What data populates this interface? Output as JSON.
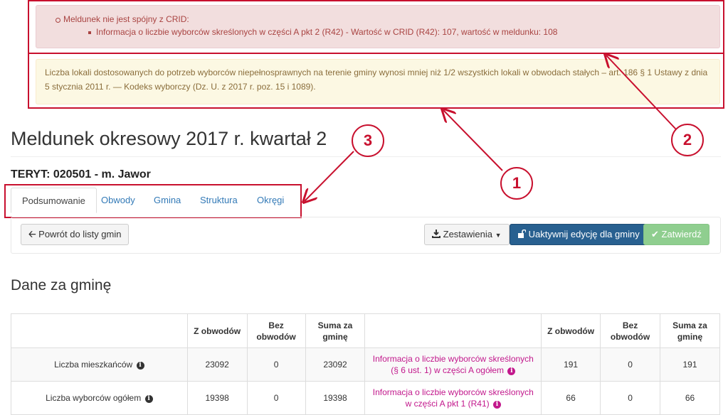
{
  "alerts": {
    "danger_line1": "Meldunek nie jest spójny z CRID:",
    "danger_line2": "Informacja o liczbie wyborców skreślonych w części A pkt 2 (R42) - Wartość w CRID (R42): 107, wartość w meldunku: 108",
    "warning_text": "Liczba lokali dostosowanych do potrzeb wyborców niepełnosprawnych na terenie gminy wynosi mniej niż 1/2 wszystkich lokali w obwodach stałych – art. 186 § 1 Ustawy z dnia 5 stycznia 2011 r. — Kodeks wyborczy (Dz. U. z 2017 r. poz. 15 i 1089)."
  },
  "annotations": {
    "n1": "1",
    "n2": "2",
    "n3": "3"
  },
  "page": {
    "title": "Meldunek okresowy 2017 r. kwartał 2",
    "teryt": "TERYT: 020501 - m. Jawor"
  },
  "tabs": [
    "Podsumowanie",
    "Obwody",
    "Gmina",
    "Struktura",
    "Okręgi"
  ],
  "toolbar": {
    "back_label": "Powrót do listy gmin",
    "summaries_label": "Zestawienia",
    "activate_label": "Uaktywnij edycję dla gminy",
    "approve_label": "Zatwierdź"
  },
  "section_title": "Dane za gminę",
  "table": {
    "headers": [
      "",
      "Z obwodów",
      "Bez obwodów",
      "Suma za gminę",
      "",
      "Z obwodów",
      "Bez obwodów",
      "Suma za gminę"
    ],
    "rows": [
      {
        "label": "Liczba mieszkańców",
        "z_obwodow": "23092",
        "bez_obwodow": "0",
        "suma": "23092",
        "label2": "Informacja o liczbie wyborców skreślonych (§ 6 ust. 1) w części A ogółem",
        "z_obwodow2": "191",
        "bez_obwodow2": "0",
        "suma2": "191"
      },
      {
        "label": "Liczba wyborców ogółem",
        "z_obwodow": "19398",
        "bez_obwodow": "0",
        "suma": "19398",
        "label2": "Informacja o liczbie wyborców skreślonych w części A pkt 1 (R41)",
        "z_obwodow2": "66",
        "bez_obwodow2": "0",
        "suma2": "66"
      }
    ]
  },
  "colors": {
    "annotation": "#c8102e",
    "link": "#337ab7",
    "primary": "#286090",
    "success": "#8fce8f",
    "pink_link": "#c2188c"
  }
}
